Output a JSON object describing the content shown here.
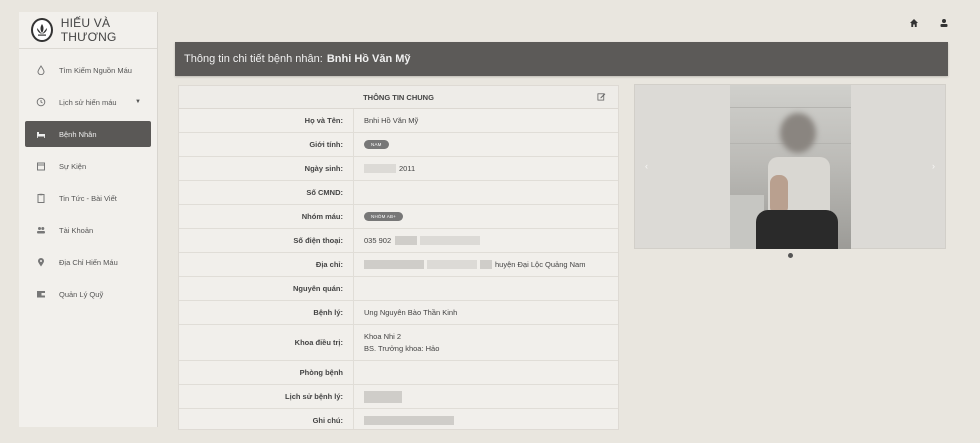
{
  "brand": {
    "name": "HIẾU VÀ THƯƠNG",
    "icon": "lotus-logo-icon"
  },
  "sidebar": {
    "items": [
      {
        "label": "Tìm Kiếm Nguồn Máu",
        "icon": "drop-icon",
        "active": false
      },
      {
        "label": "Lịch sử hiến máu",
        "icon": "history-icon",
        "active": false,
        "has_caret": true
      },
      {
        "label": "Bệnh Nhân",
        "icon": "bed-icon",
        "active": true
      },
      {
        "label": "Sự Kiện",
        "icon": "calendar-icon",
        "active": false
      },
      {
        "label": "Tin Tức - Bài Viết",
        "icon": "clipboard-icon",
        "active": false
      },
      {
        "label": "Tài Khoản",
        "icon": "users-icon",
        "active": false
      },
      {
        "label": "Địa Chỉ Hiến Máu",
        "icon": "map-pin-icon",
        "active": false
      },
      {
        "label": "Quản Lý Quỹ",
        "icon": "wallet-icon",
        "active": false
      }
    ]
  },
  "topbar": {
    "home_icon": "home-icon",
    "user_icon": "user-icon"
  },
  "header": {
    "prefix": "Thông tin chi tiết bệnh nhân:",
    "patient": "Bnhi Hồ Văn Mỹ"
  },
  "info": {
    "title": "THÔNG TIN CHUNG",
    "rows": {
      "name": {
        "label": "Họ và Tên:",
        "value": "Bnhi Hồ Văn Mỹ"
      },
      "gender": {
        "label": "Giới tính:",
        "value": "NAM"
      },
      "dob": {
        "label": "Ngày sinh:",
        "value": "2011"
      },
      "cmnd": {
        "label": "Số CMND:",
        "value": ""
      },
      "blood": {
        "label": "Nhóm máu:",
        "value": "NHÓM AB+"
      },
      "phone": {
        "label": "Số điện thoại:",
        "value": "035 902"
      },
      "address": {
        "label": "Địa chỉ:",
        "value": "huyện Đại Lộc Quảng Nam"
      },
      "hometown": {
        "label": "Nguyên quán:",
        "value": ""
      },
      "disease": {
        "label": "Bệnh lý:",
        "value": "Ung Nguyên Bào Thần Kinh"
      },
      "dept": {
        "label": "Khoa điều trị:",
        "line1": "Khoa Nhi 2",
        "line2": "BS. Trưởng khoa: Hảo"
      },
      "room": {
        "label": "Phòng bệnh",
        "value": ""
      },
      "history": {
        "label": "Lịch sử bệnh lý:",
        "value": ""
      },
      "note": {
        "label": "Ghi chú:",
        "value": ""
      }
    }
  },
  "colors": {
    "header_bg": "#5c5a58",
    "active_nav": "#5a5856",
    "page_bg": "#e9e6df"
  }
}
